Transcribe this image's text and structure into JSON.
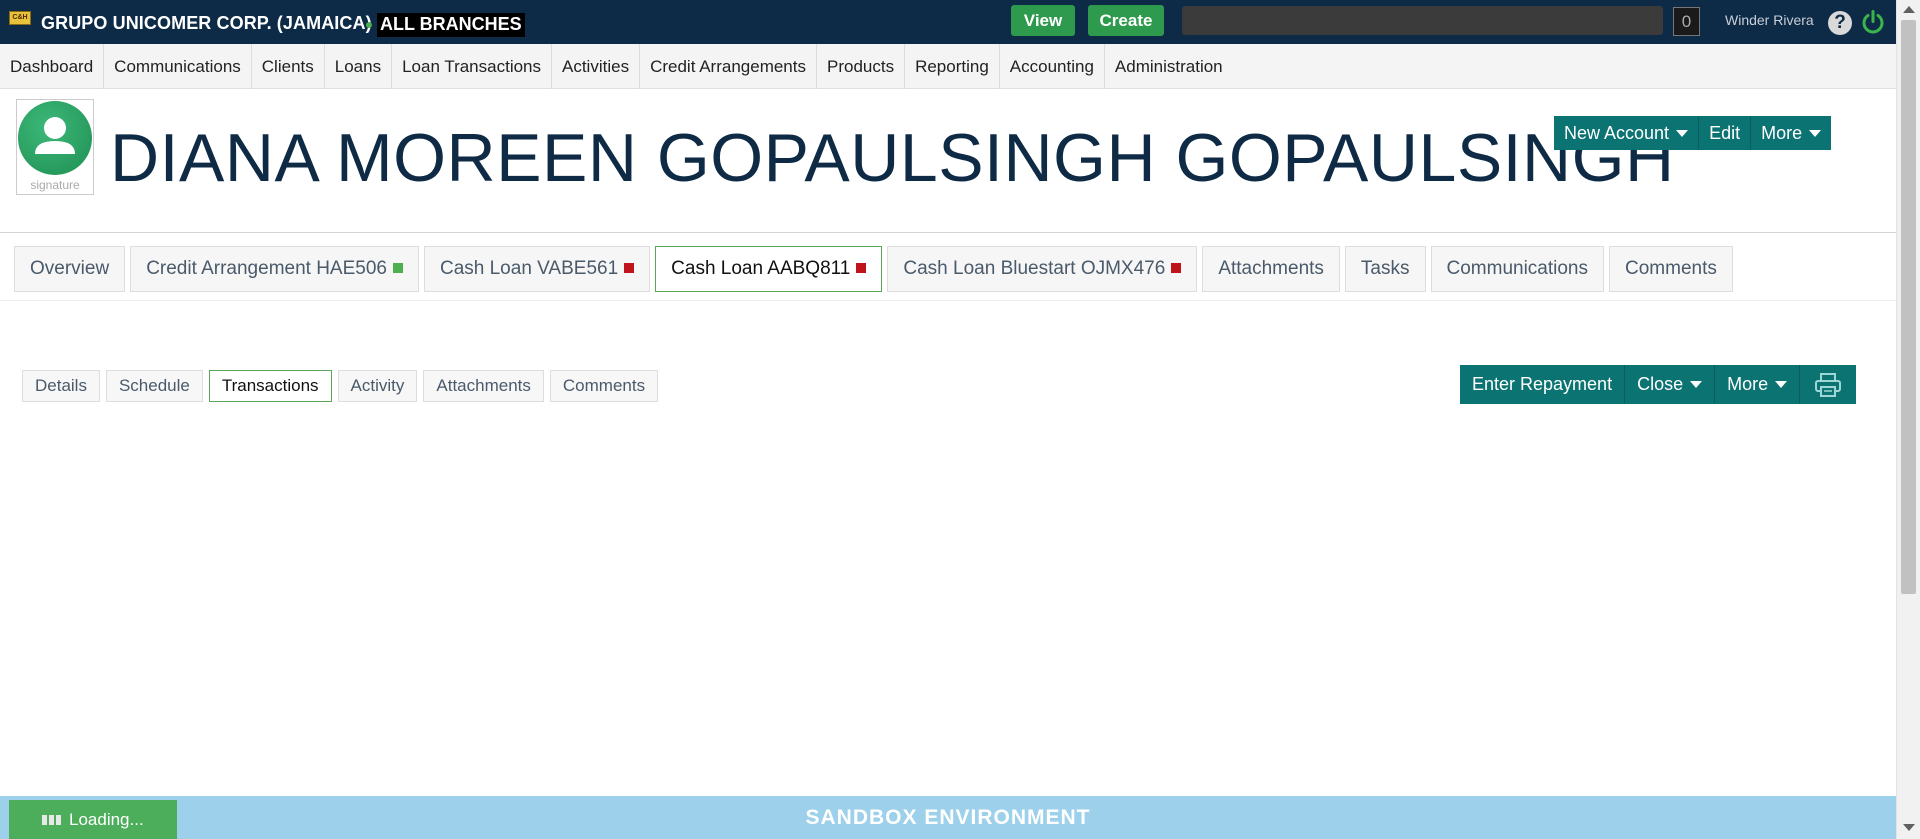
{
  "topbar": {
    "company": "GRUPO UNICOMER CORP. (JAMAICA)",
    "branches": "ALL BRANCHES",
    "view_label": "View",
    "create_label": "Create",
    "search_value": "",
    "counter": "0",
    "user": "Winder Rivera",
    "help_icon": "?",
    "logo_text": "C&H",
    "colors": {
      "background": "#0d2a47",
      "action_green": "#2e9a4e"
    }
  },
  "menu": {
    "items": [
      {
        "label": "Dashboard"
      },
      {
        "label": "Communications"
      },
      {
        "label": "Clients"
      },
      {
        "label": "Loans"
      },
      {
        "label": "Loan Transactions"
      },
      {
        "label": "Activities"
      },
      {
        "label": "Credit Arrangements"
      },
      {
        "label": "Products"
      },
      {
        "label": "Reporting"
      },
      {
        "label": "Accounting"
      },
      {
        "label": "Administration"
      }
    ]
  },
  "client": {
    "name": "DIANA MOREEN GOPAULSINGH GOPAULSINGH",
    "signature_label": "signature",
    "actions": {
      "new_account": "New Account",
      "edit": "Edit",
      "more": "More"
    }
  },
  "account_tabs": [
    {
      "label": "Overview",
      "status": null
    },
    {
      "label": "Credit Arrangement HAE506",
      "status": "#4caf50"
    },
    {
      "label": "Cash Loan VABE561",
      "status": "#c0141c"
    },
    {
      "label": "Cash Loan AABQ811",
      "status": "#c0141c",
      "active": true
    },
    {
      "label": "Cash Loan Bluestart OJMX476",
      "status": "#c0141c"
    },
    {
      "label": "Attachments",
      "status": null
    },
    {
      "label": "Tasks",
      "status": null
    },
    {
      "label": "Communications",
      "status": null
    },
    {
      "label": "Comments",
      "status": null
    }
  ],
  "loan": {
    "sub_tabs": [
      {
        "label": "Details"
      },
      {
        "label": "Schedule"
      },
      {
        "label": "Transactions",
        "active": true
      },
      {
        "label": "Activity"
      },
      {
        "label": "Attachments"
      },
      {
        "label": "Comments"
      }
    ],
    "actions": {
      "enter_repayment": "Enter Repayment",
      "close": "Close",
      "more": "More",
      "print_icon": "printer-icon"
    }
  },
  "footer": {
    "environment": "SANDBOX ENVIRONMENT",
    "loading": "Loading..."
  },
  "theme": {
    "teal": "#0c7373",
    "navy": "#0e2a45",
    "sandbox_blue": "#9dd0ea"
  }
}
